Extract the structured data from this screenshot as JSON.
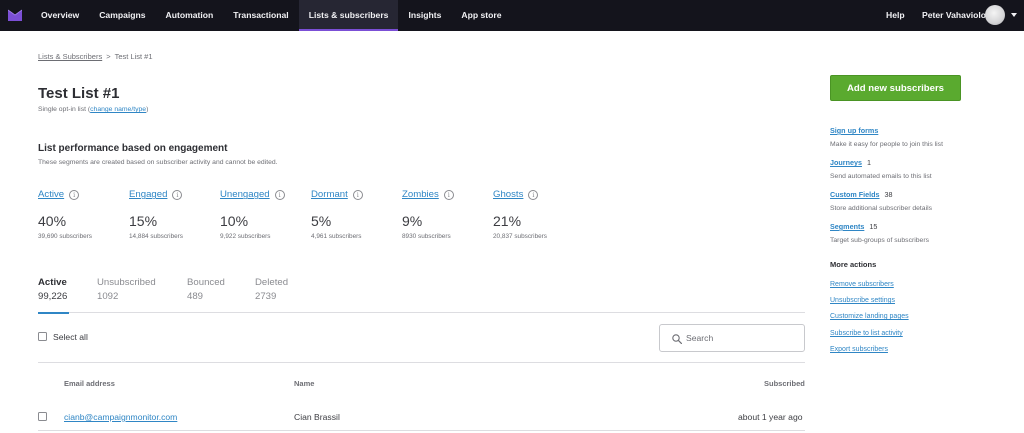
{
  "nav": {
    "items": [
      {
        "label": "Overview",
        "active": false
      },
      {
        "label": "Campaigns",
        "active": false
      },
      {
        "label": "Automation",
        "active": false
      },
      {
        "label": "Transactional",
        "active": false
      },
      {
        "label": "Lists & subscribers",
        "active": true
      },
      {
        "label": "Insights",
        "active": false
      },
      {
        "label": "App store",
        "active": false
      }
    ],
    "help": "Help",
    "user_name": "Peter Vahaviolos",
    "logo_icon": "campaign-monitor-logo-icon",
    "accent_color": "#7b4fd6"
  },
  "breadcrumb": {
    "parent": "Lists & Subscribers",
    "separator": ">",
    "current": "Test List #1"
  },
  "header": {
    "title": "Test List #1",
    "list_type_prefix": "Single opt-in list (",
    "list_type_link": "change name/type",
    "list_type_suffix": ")"
  },
  "performance": {
    "title": "List performance based on engagement",
    "description": "These segments are created based on subscriber activity and cannot be edited.",
    "segments": [
      {
        "label": "Active",
        "percent": "40%",
        "count": "39,690 subscribers"
      },
      {
        "label": "Engaged",
        "percent": "15%",
        "count": "14,884 subscribers"
      },
      {
        "label": "Unengaged",
        "percent": "10%",
        "count": "9,922 subscribers"
      },
      {
        "label": "Dormant",
        "percent": "5%",
        "count": "4,961 subscribers"
      },
      {
        "label": "Zombies",
        "percent": "9%",
        "count": "8930 subscribers"
      },
      {
        "label": "Ghosts",
        "percent": "21%",
        "count": "20,837 subscribers"
      }
    ],
    "info_icon": "info-icon",
    "info_glyph": "i"
  },
  "tabs": [
    {
      "label": "Active",
      "count": "99,226",
      "active": true
    },
    {
      "label": "Unsubscribed",
      "count": "1092",
      "active": false
    },
    {
      "label": "Bounced",
      "count": "489",
      "active": false
    },
    {
      "label": "Deleted",
      "count": "2739",
      "active": false
    }
  ],
  "toolbar": {
    "select_all": "Select all",
    "search_placeholder": "Search"
  },
  "table": {
    "columns": [
      "Email address",
      "Name",
      "Subscribed"
    ],
    "rows": [
      {
        "email": "cianb@campaignmonitor.com",
        "name": "Cian Brassil",
        "subscribed": "about 1 year ago"
      }
    ]
  },
  "sidebar": {
    "add_button": "Add new subscribers",
    "button_color": "#5aaa2f",
    "link_color": "#2f86c5",
    "items": [
      {
        "label": "Sign up forms",
        "count": "",
        "description": "Make it easy for people to join this list"
      },
      {
        "label": "Journeys",
        "count": "1",
        "description": "Send automated emails to this list"
      },
      {
        "label": "Custom Fields",
        "count": "38",
        "description": "Store additional subscriber details"
      },
      {
        "label": "Segments",
        "count": "15",
        "description": "Target sub-groups of subscribers"
      }
    ],
    "more_actions_title": "More actions",
    "more_actions": [
      "Remove subscribers",
      "Unsubscribe settings",
      "Customize landing pages",
      "Subscribe to list activity",
      "Export subscribers"
    ]
  }
}
